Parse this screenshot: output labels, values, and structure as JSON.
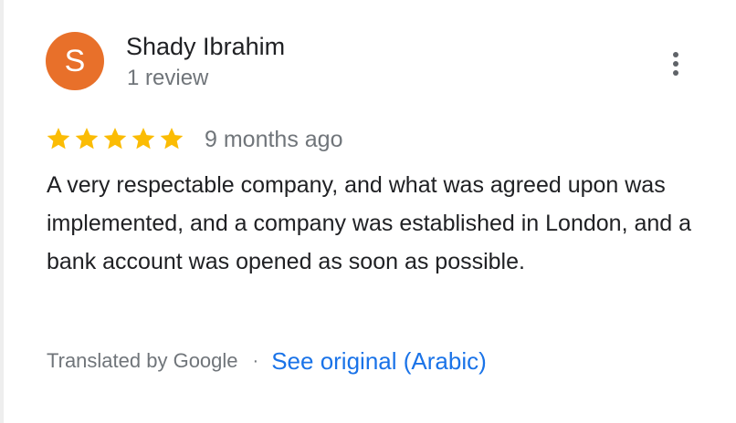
{
  "reviewer": {
    "initial": "S",
    "name": "Shady Ibrahim",
    "review_count": "1 review",
    "avatar_color": "#e8702a"
  },
  "menu": {
    "icon": "more-vertical-icon"
  },
  "rating": {
    "stars": 5,
    "max_stars": 5,
    "star_color": "#fbbc04",
    "star_icon": "star-icon"
  },
  "review": {
    "date": "9 months ago",
    "text": "A very respectable company, and what was agreed upon was implemented, and a company was established in London, and a bank account was opened as soon as possible."
  },
  "translation": {
    "label": "Translated by Google",
    "separator": "·",
    "link_label": "See original (Arabic)",
    "link_color": "#1a73e8"
  }
}
